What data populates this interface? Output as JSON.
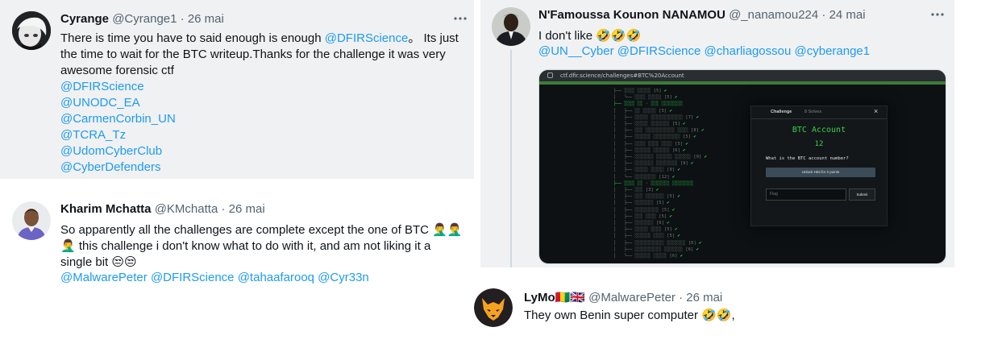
{
  "tweets": {
    "cyrange": {
      "name": "Cyrange",
      "handle": "@Cyrange1",
      "date": "· 26 mai",
      "text_lines": [
        "There is time you have to said enough is enough ",
        "the time to wait for the BTC writeup.Thanks for the challenge it was very",
        "awesome forensic ctf"
      ],
      "inline_mention": "@DFIRScience",
      "line1_tail": "。 Its just",
      "mentions": [
        "@DFIRScience",
        "@UNODC_EA",
        "@CarmenCorbin_UN",
        "@TCRA_Tz",
        "@UdomCyberClub",
        "@CyberDefenders"
      ]
    },
    "kharim": {
      "name": "Kharim Mchatta",
      "handle": "@KMchatta",
      "date": "· 26 mai",
      "line1": "So apparently all the challenges are complete except the one of BTC ",
      "line1_emoji": "🤦‍♂️🤦‍♂️",
      "line2_emoji": "🤦‍♂️",
      "line2": " this challenge i don't know what to do with it, and am not liking it a",
      "line3": "single bit ",
      "line3_emoji": "😒😒",
      "mentions": [
        "@MalwarePeter",
        "@DFIRScience",
        "@tahaafarooq",
        "@Cyr33n"
      ]
    },
    "famoussa": {
      "name": "N'Famoussa Kounon NANAMOU",
      "handle": "@_nanamou224",
      "date": "· 24 mai",
      "line1": "I don't like ",
      "line1_emoji": "🤣🤣🤣",
      "mentions": [
        "@UN__Cyber",
        "@DFIRScience",
        "@charliagossou",
        "@cyberange1"
      ],
      "screenshot": {
        "url": "ctf.dfir.science/challenges#BTC%20Account",
        "modal_tab_active": "Challenge",
        "modal_tab_other": "8 Solves",
        "modal_close": "×",
        "modal_title": "BTC Account",
        "modal_points": "12",
        "question": "What is the BTC account number?",
        "unlock_label": "Unlock Hint for 2 points",
        "flag_placeholder": "Flag",
        "submit_label": "Submit"
      }
    },
    "lymo": {
      "name": "LyMo",
      "name_flags": "🇬🇳🇬🇧",
      "handle": "@MalwarePeter",
      "date": "· 26 mai",
      "line1": "They own Benin super computer ",
      "line1_emoji": "🤣🤣",
      "line1_tail": ","
    }
  },
  "icons": {
    "more": "more-horizontal-icon"
  },
  "colors": {
    "link": "#1d9bf0",
    "text": "#0f1419",
    "meta": "#536471",
    "highlight_bg": "#f0f1f2",
    "ctf_green": "#37d04e"
  }
}
